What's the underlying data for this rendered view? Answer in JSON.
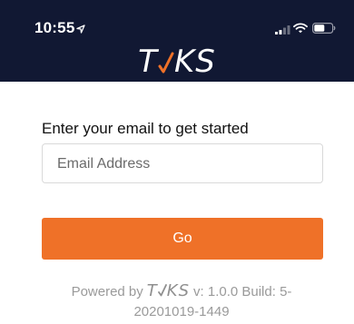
{
  "status_bar": {
    "time": "10:55",
    "icons": [
      "location-arrow-icon",
      "signal-icon",
      "wifi-icon",
      "battery-icon"
    ]
  },
  "brand": {
    "logo_prefix": "T",
    "logo_suffix": "KS",
    "header_color": "#111833",
    "accent_color": "#ef7128"
  },
  "form": {
    "prompt": "Enter your email to get started",
    "email_placeholder": "Email Address",
    "email_value": "",
    "go_label": "Go"
  },
  "footer": {
    "powered_by": "Powered by",
    "logo_prefix": "T",
    "logo_suffix": "KS",
    "version_line1": "v: 1.0.0 Build: 5-",
    "version_line2": "20201019-1449"
  }
}
